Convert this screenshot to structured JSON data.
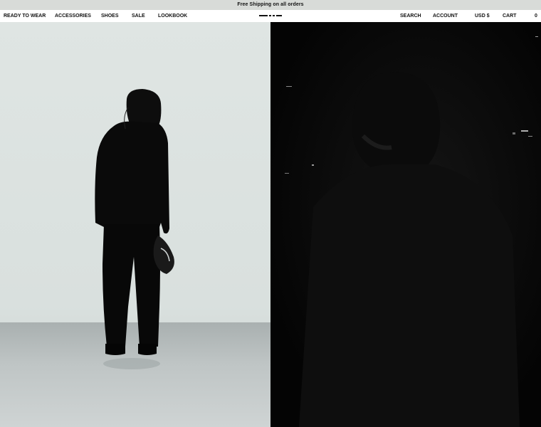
{
  "announcement": {
    "text": "Free Shipping on all orders"
  },
  "nav": {
    "left": [
      "READY TO WEAR",
      "ACCESSORIES",
      "SHOES",
      "SALE",
      "LOOKBOOK"
    ],
    "search": "SEARCH",
    "account": "ACCOUNT",
    "currency": "USD $",
    "cart": "CART",
    "cart_count": "0"
  },
  "hero": {
    "left_image": "model-standing-photo",
    "right_image": "dark-model-photo"
  }
}
